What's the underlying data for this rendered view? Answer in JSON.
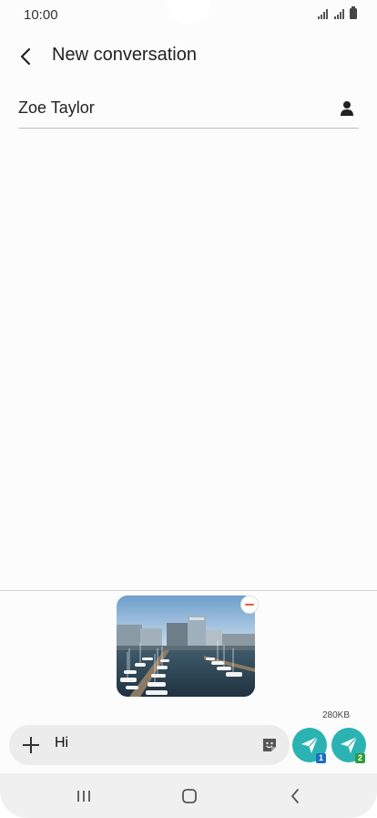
{
  "status_bar": {
    "time": "10:00"
  },
  "header": {
    "title": "New conversation"
  },
  "recipient": {
    "name": "Zoe Taylor"
  },
  "attachment": {
    "size": "280KB"
  },
  "composer": {
    "text": "Hi"
  },
  "send": {
    "sim1_label": "1",
    "sim2_label": "2"
  },
  "colors": {
    "accent": "#2bb3b3",
    "sim1": "#1b6fc1",
    "sim2": "#2e9b3a",
    "remove": "#e85c3c"
  },
  "icons": [
    "back-arrow-icon",
    "contact-icon",
    "remove-icon",
    "plus-icon",
    "sticker-icon",
    "send-icon",
    "recents-icon",
    "home-icon",
    "nav-back-icon"
  ]
}
